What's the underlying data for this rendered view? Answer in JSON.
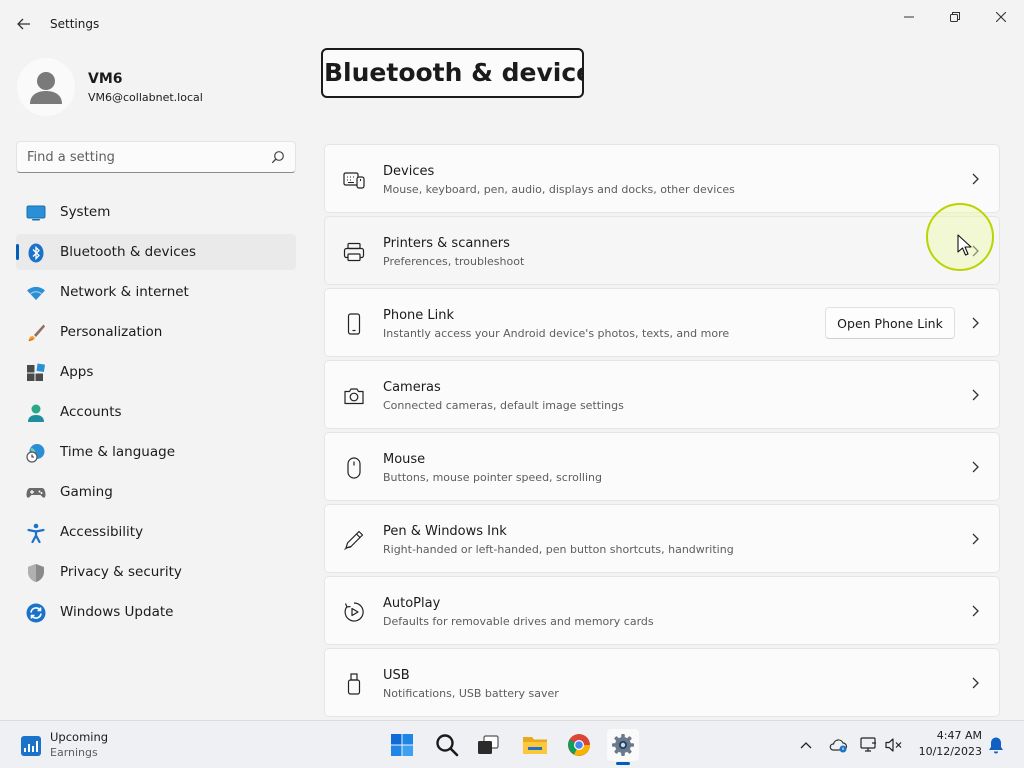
{
  "window": {
    "title": "Settings",
    "controls": {
      "minimize": "minimize",
      "maximize": "maximize",
      "close": "close"
    }
  },
  "profile": {
    "name": "VM6",
    "email": "VM6@collabnet.local"
  },
  "search": {
    "placeholder": "Find a setting"
  },
  "nav": {
    "items": [
      {
        "label": "System",
        "icon": "system-icon"
      },
      {
        "label": "Bluetooth & devices",
        "icon": "bluetooth-icon",
        "active": true
      },
      {
        "label": "Network & internet",
        "icon": "wifi-icon"
      },
      {
        "label": "Personalization",
        "icon": "brush-icon"
      },
      {
        "label": "Apps",
        "icon": "apps-icon"
      },
      {
        "label": "Accounts",
        "icon": "accounts-icon"
      },
      {
        "label": "Time & language",
        "icon": "globe-clock-icon"
      },
      {
        "label": "Gaming",
        "icon": "gamepad-icon"
      },
      {
        "label": "Accessibility",
        "icon": "accessibility-icon"
      },
      {
        "label": "Privacy & security",
        "icon": "shield-icon"
      },
      {
        "label": "Windows Update",
        "icon": "update-icon"
      }
    ]
  },
  "page": {
    "title": "Bluetooth & devices"
  },
  "cards": [
    {
      "title": "Devices",
      "subtitle": "Mouse, keyboard, pen, audio, displays and docks, other devices",
      "icon": "devices-icon"
    },
    {
      "title": "Printers & scanners",
      "subtitle": "Preferences, troubleshoot",
      "icon": "printer-icon"
    },
    {
      "title": "Phone Link",
      "subtitle": "Instantly access your Android device's photos, texts, and more",
      "icon": "phone-icon",
      "button": "Open Phone Link"
    },
    {
      "title": "Cameras",
      "subtitle": "Connected cameras, default image settings",
      "icon": "camera-icon"
    },
    {
      "title": "Mouse",
      "subtitle": "Buttons, mouse pointer speed, scrolling",
      "icon": "mouse-icon"
    },
    {
      "title": "Pen & Windows Ink",
      "subtitle": "Right-handed or left-handed, pen button shortcuts, handwriting",
      "icon": "pen-icon"
    },
    {
      "title": "AutoPlay",
      "subtitle": "Defaults for removable drives and memory cards",
      "icon": "autoplay-icon"
    },
    {
      "title": "USB",
      "subtitle": "Notifications, USB battery saver",
      "icon": "usb-icon"
    }
  ],
  "taskbar": {
    "widget": {
      "title": "Upcoming",
      "subtitle": "Earnings"
    },
    "pinned": [
      "windows-start-icon",
      "search-icon",
      "task-view-icon",
      "file-explorer-icon",
      "chrome-icon",
      "settings-icon"
    ],
    "tray": [
      "chevron-up-icon",
      "onedrive-icon",
      "network-icon",
      "volume-muted-icon",
      "notification-bell-icon"
    ],
    "clock": {
      "time": "4:47 AM",
      "date": "10/12/2023"
    }
  },
  "colors": {
    "accent": "#005fb8",
    "background": "#f3f3f3",
    "card": "#fbfbfb",
    "cursor_highlight": "#b9d400"
  }
}
